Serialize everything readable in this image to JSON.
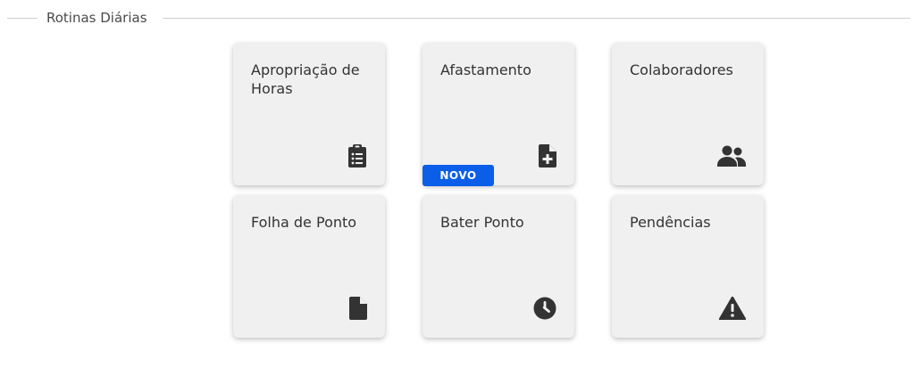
{
  "section": {
    "title": "Rotinas Diárias"
  },
  "cards": [
    {
      "label": "Apropriação de Horas",
      "icon": "clipboard-list-icon"
    },
    {
      "label": "Afastamento",
      "icon": "file-plus-icon",
      "badge": "NOVO"
    },
    {
      "label": "Colaboradores",
      "icon": "users-icon"
    },
    {
      "label": "Folha de Ponto",
      "icon": "file-icon"
    },
    {
      "label": "Bater Ponto",
      "icon": "clock-icon"
    },
    {
      "label": "Pendências",
      "icon": "warning-icon"
    }
  ],
  "colors": {
    "card_bg": "#f0f0f0",
    "badge_bg": "#0a5ee8",
    "icon": "#333333"
  }
}
